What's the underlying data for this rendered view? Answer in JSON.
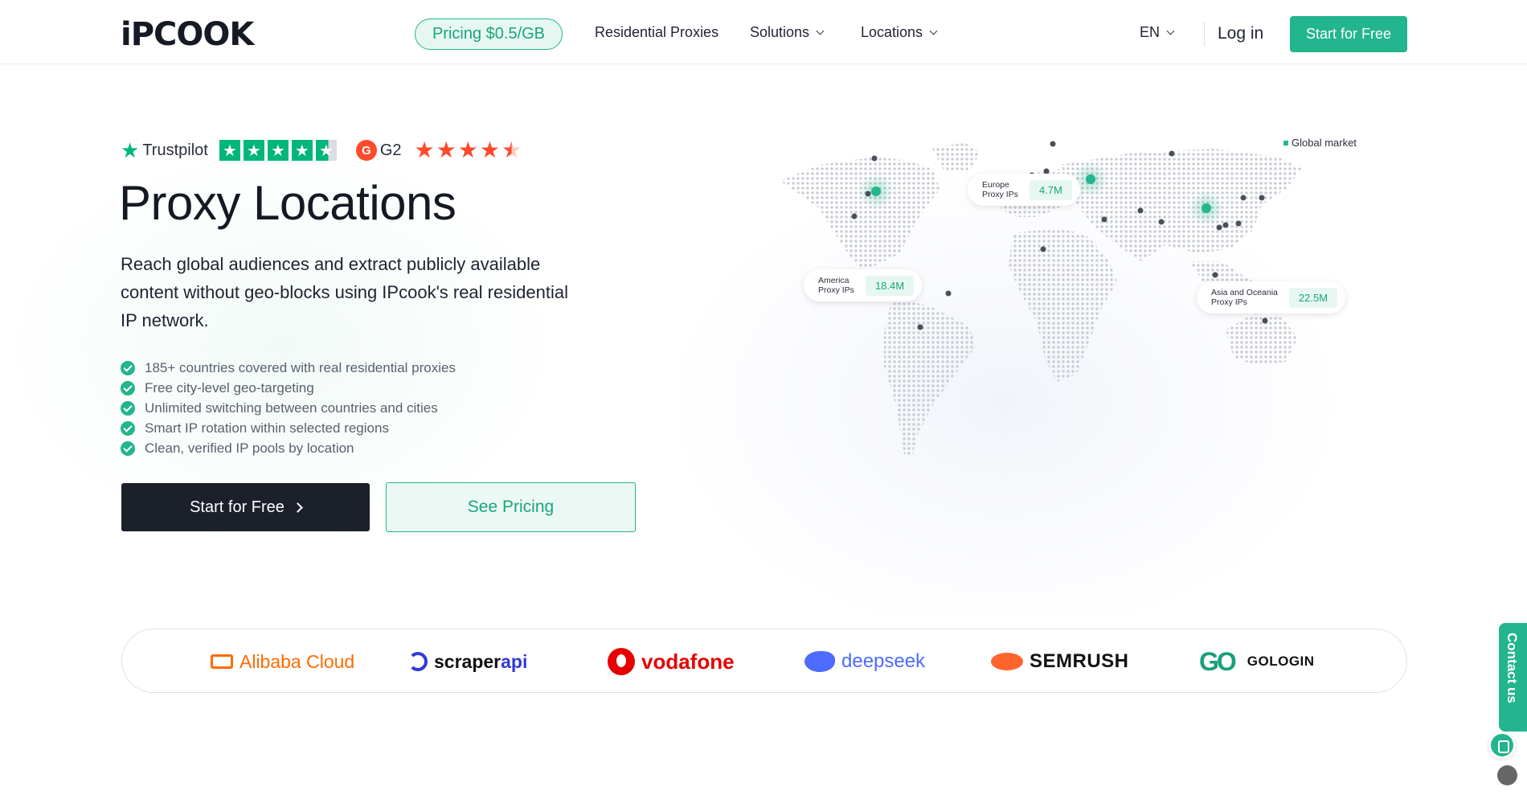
{
  "header": {
    "logo": "iPCOOK",
    "pricing_pill": "Pricing $0.5/GB",
    "nav": [
      "Residential Proxies",
      "Solutions",
      "Locations"
    ],
    "language": "EN",
    "login": "Log in",
    "cta": "Start for Free"
  },
  "ratings": {
    "trustpilot_label": "Trustpilot",
    "trustpilot_stars": 4.5,
    "g2_label": "G2",
    "g2_stars": 4.5
  },
  "hero": {
    "title": "Proxy Locations",
    "subtitle": "Reach global audiences and extract publicly available content without geo-blocks using IPcook's real residential IP network.",
    "features": [
      "185+ countries covered with real residential proxies",
      "Free city-level geo-targeting",
      "Unlimited switching between countries and cities",
      "Smart IP rotation within selected regions",
      "Clean, verified IP pools by location"
    ],
    "primary_button": "Start for Free",
    "secondary_button": "See Pricing"
  },
  "map": {
    "legend": "Global market",
    "cards": [
      {
        "line1": "America",
        "line2": "Proxy IPs",
        "value": "18.4M"
      },
      {
        "line1": "Europe",
        "line2": "Proxy IPs",
        "value": "4.7M"
      },
      {
        "line1": "Asia and Oceania",
        "line2": "Proxy IPs",
        "value": "22.5M"
      }
    ]
  },
  "partners": {
    "alibaba": "Alibaba Cloud",
    "scraper_a": "scraper",
    "scraper_b": "api",
    "vodafone": "vodafone",
    "deepseek": "deepseek",
    "semrush": "SEMRUSH",
    "gologin_mark": "GO",
    "gologin": "GOLOGIN"
  },
  "contact": "Contact us",
  "colors": {
    "accent": "#23b58d",
    "dark": "#1c202b",
    "trustpilot": "#00b67a",
    "g2": "#ff492c"
  }
}
